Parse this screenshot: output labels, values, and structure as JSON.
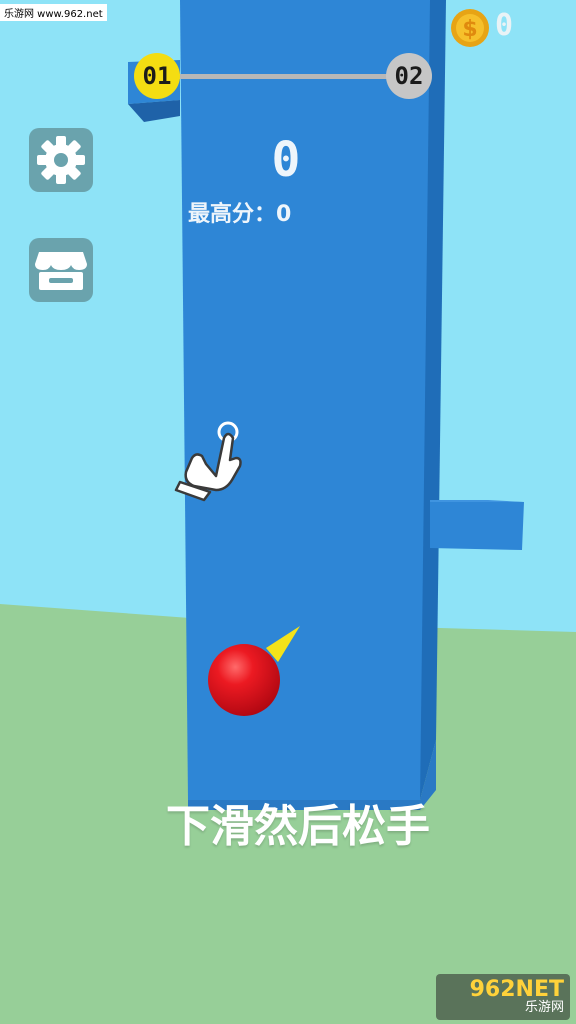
{
  "watermark_top": "乐游网 www.962.net",
  "coins": {
    "count": "0",
    "icon": "dollar-coin-icon",
    "color": "#f2b51c"
  },
  "progress": {
    "current_level": "01",
    "next_level": "02",
    "fraction": 0
  },
  "score": {
    "value": "0",
    "best_label": "最高分：0"
  },
  "buttons": {
    "settings_icon": "gear-icon",
    "shop_icon": "shop-icon"
  },
  "hint": "下滑然后松手",
  "watermark_bottom": {
    "brand": "962NET",
    "site": "乐游网"
  },
  "colors": {
    "sky": "#8ee3f7",
    "ground": "#97cf98",
    "tower": "#2e86d6",
    "ball": "#e8111b",
    "level_current": "#f4dd12"
  }
}
